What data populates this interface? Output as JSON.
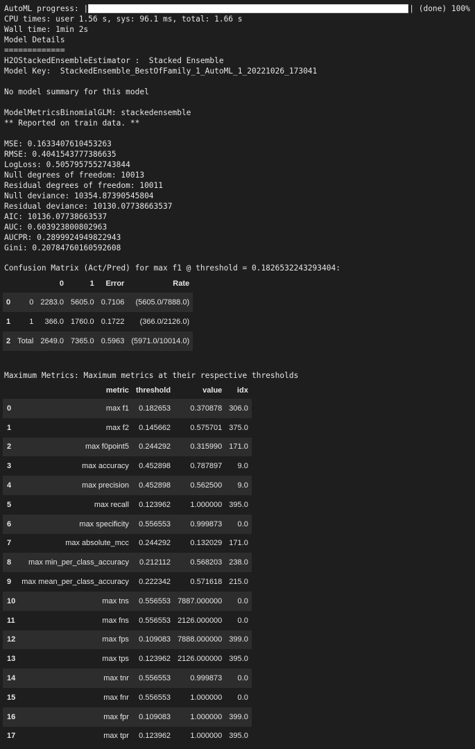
{
  "progress": {
    "label": "AutoML progress: |",
    "value_percent": 100,
    "suffix": "| (done) 100%"
  },
  "log_lines": [
    "CPU times: user 1.56 s, sys: 96.1 ms, total: 1.66 s",
    "Wall time: 1min 2s",
    "Model Details",
    "=============",
    "H2OStackedEnsembleEstimator :  Stacked Ensemble",
    "Model Key:  StackedEnsemble_BestOfFamily_1_AutoML_1_20221026_173041",
    "",
    "No model summary for this model",
    "",
    "ModelMetricsBinomialGLM: stackedensemble",
    "** Reported on train data. **",
    "",
    "MSE: 0.1633407610453263",
    "RMSE: 0.4041543777386635",
    "LogLoss: 0.5057957552743844",
    "Null degrees of freedom: 10013",
    "Residual degrees of freedom: 10011",
    "Null deviance: 10354.87390545804",
    "Residual deviance: 10130.07738663537",
    "AIC: 10136.07738663537",
    "AUC: 0.603923800802963",
    "AUCPR: 0.2899924949822943",
    "Gini: 0.20784760160592608"
  ],
  "confusion_matrix": {
    "title": "Confusion Matrix (Act/Pred) for max f1 @ threshold = 0.1826532243293404:",
    "headers": [
      "",
      "",
      "0",
      "1",
      "Error",
      "Rate"
    ],
    "rows": [
      [
        "0",
        "0",
        "2283.0",
        "5605.0",
        "0.7106",
        "(5605.0/7888.0)"
      ],
      [
        "1",
        "1",
        "366.0",
        "1760.0",
        "0.1722",
        "(366.0/2126.0)"
      ],
      [
        "2",
        "Total",
        "2649.0",
        "7365.0",
        "0.5963",
        "(5971.0/10014.0)"
      ]
    ]
  },
  "maximum_metrics": {
    "title": "Maximum Metrics: Maximum metrics at their respective thresholds",
    "headers": [
      "",
      "metric",
      "threshold",
      "value",
      "idx"
    ],
    "rows": [
      [
        "0",
        "max f1",
        "0.182653",
        "0.370878",
        "306.0"
      ],
      [
        "1",
        "max f2",
        "0.145662",
        "0.575701",
        "375.0"
      ],
      [
        "2",
        "max f0point5",
        "0.244292",
        "0.315990",
        "171.0"
      ],
      [
        "3",
        "max accuracy",
        "0.452898",
        "0.787897",
        "9.0"
      ],
      [
        "4",
        "max precision",
        "0.452898",
        "0.562500",
        "9.0"
      ],
      [
        "5",
        "max recall",
        "0.123962",
        "1.000000",
        "395.0"
      ],
      [
        "6",
        "max specificity",
        "0.556553",
        "0.999873",
        "0.0"
      ],
      [
        "7",
        "max absolute_mcc",
        "0.244292",
        "0.132029",
        "171.0"
      ],
      [
        "8",
        "max min_per_class_accuracy",
        "0.212112",
        "0.568203",
        "238.0"
      ],
      [
        "9",
        "max mean_per_class_accuracy",
        "0.222342",
        "0.571618",
        "215.0"
      ],
      [
        "10",
        "max tns",
        "0.556553",
        "7887.000000",
        "0.0"
      ],
      [
        "11",
        "max fns",
        "0.556553",
        "2126.000000",
        "0.0"
      ],
      [
        "12",
        "max fps",
        "0.109083",
        "7888.000000",
        "399.0"
      ],
      [
        "13",
        "max tps",
        "0.123962",
        "2126.000000",
        "395.0"
      ],
      [
        "14",
        "max tnr",
        "0.556553",
        "0.999873",
        "0.0"
      ],
      [
        "15",
        "max fnr",
        "0.556553",
        "1.000000",
        "0.0"
      ],
      [
        "16",
        "max fpr",
        "0.109083",
        "1.000000",
        "399.0"
      ],
      [
        "17",
        "max tpr",
        "0.123962",
        "1.000000",
        "395.0"
      ]
    ]
  }
}
